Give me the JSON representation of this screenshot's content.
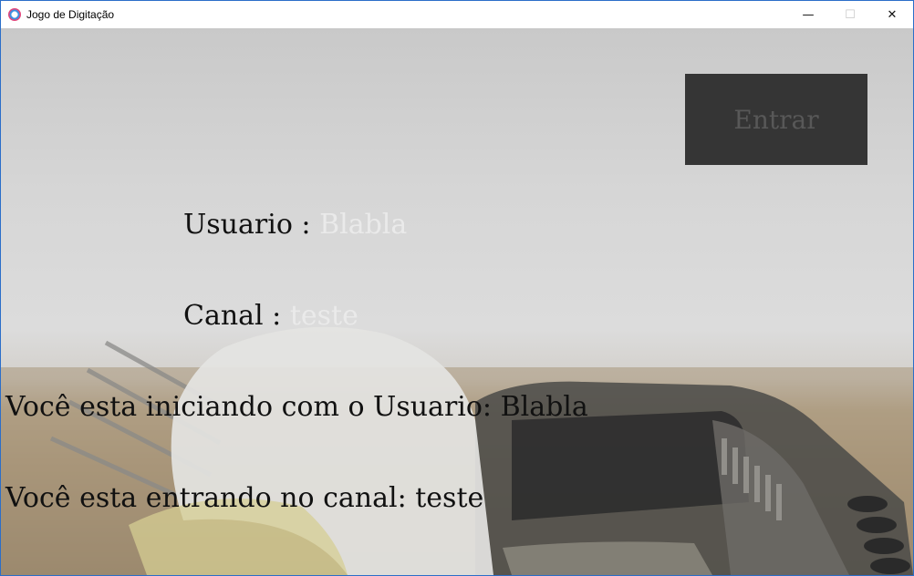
{
  "window": {
    "title": "Jogo de Digitação",
    "minimize_glyph": "—",
    "maximize_glyph": "☐",
    "close_glyph": "✕"
  },
  "form": {
    "enter_button_label": "Entrar",
    "user_label": "Usuario : ",
    "user_value": "Blabla",
    "channel_label": "Canal : ",
    "channel_value": "teste"
  },
  "status": {
    "user_line_prefix": "Você esta iniciando com o Usuario:  ",
    "user_line_value": "Blabla",
    "channel_line_prefix": "Você esta entrando no canal: ",
    "channel_line_value": "teste"
  },
  "colors": {
    "button_bg": "#353535",
    "button_text": "#585858",
    "value_text": "#eaeaea",
    "window_border": "#2b6ec9"
  },
  "icons": {
    "app": "app-logo-icon",
    "minimize": "minimize-icon",
    "maximize": "maximize-icon",
    "close": "close-icon"
  }
}
